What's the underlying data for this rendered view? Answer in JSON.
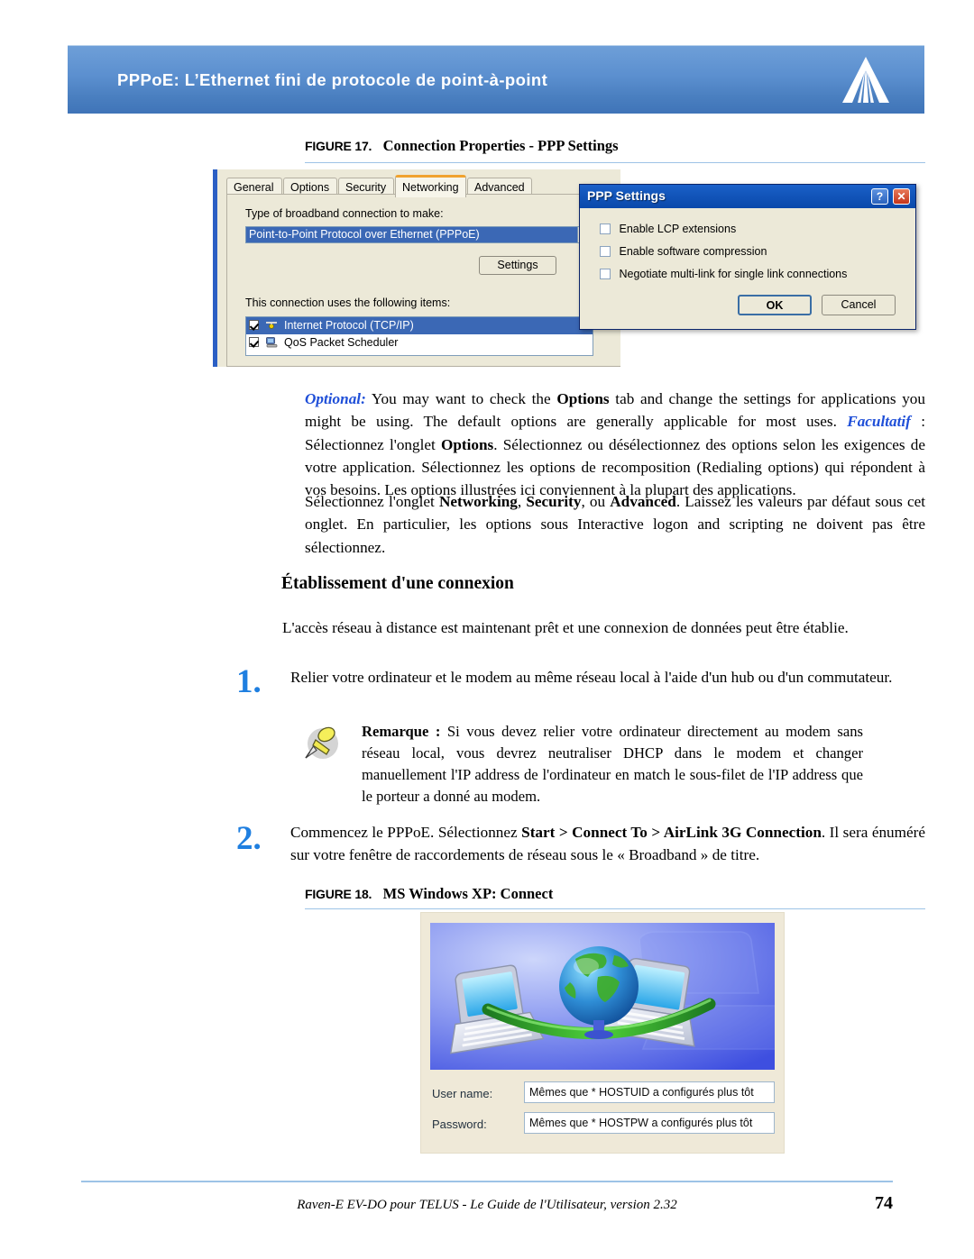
{
  "header": {
    "title": "PPPoE: L’Ethernet fini de protocole de point-à-point",
    "logo_name": "sierra-wireless-logo",
    "banner_color": "#4a7fc0"
  },
  "figure17": {
    "caption_label": "FIGURE 17.",
    "caption_title": "Connection Properties - PPP Settings",
    "connection_properties": {
      "tabs": [
        {
          "label": "General",
          "active": false
        },
        {
          "label": "Options",
          "active": false
        },
        {
          "label": "Security",
          "active": false
        },
        {
          "label": "Networking",
          "active": true
        },
        {
          "label": "Advanced",
          "active": false
        }
      ],
      "type_label": "Type of broadband connection to make:",
      "type_value": "Point-to-Point Protocol over Ethernet (PPPoE)",
      "settings_button": "Settings",
      "items_label": "This connection uses the following items:",
      "items": [
        {
          "label": "Internet Protocol (TCP/IP)",
          "checked": true,
          "selected": true
        },
        {
          "label": "QoS Packet Scheduler",
          "checked": true,
          "selected": false
        }
      ]
    },
    "ppp_settings": {
      "title": "PPP Settings",
      "help_button": "?",
      "close_button": "✕",
      "checkboxes": [
        {
          "label": "Enable LCP extensions",
          "checked": false
        },
        {
          "label": "Enable software compression",
          "checked": false
        },
        {
          "label": "Negotiate multi-link for single link connections",
          "checked": false
        }
      ],
      "ok_button": "OK",
      "cancel_button": "Cancel"
    }
  },
  "body": {
    "para_optional_prefix": "Optional:",
    "para_optional_1": " You may want to check the ",
    "para_optional_options1": "Options",
    "para_optional_2": " tab and change the settings for applications you might be using.  The default options are generally applicable for most uses. ",
    "para_optional_facultatif": "Facultatif",
    "para_optional_3": " : Sélectionnez l'onglet ",
    "para_optional_options2": "Options",
    "para_optional_4": ". Sélectionnez ou désélectionnez des options selon les exigences de votre application. Sélectionnez les options de recomposition (Redialing options) qui répondent à vos besoins. Les options illustrées ici conviennent à la plupart des applications.",
    "para_tabs_1": "Sélectionnez l'onglet ",
    "para_tabs_networking": "Networking",
    "para_tabs_2": ", ",
    "para_tabs_security": "Security",
    "para_tabs_3": ", ou ",
    "para_tabs_advanced": "Advanced",
    "para_tabs_4": ".  Laissez les valeurs par défaut sous cet onglet. En particulier, les options sous Interactive logon and scripting ne doivent pas être sélectionnez.",
    "section_heading": "Établissement d'une connexion",
    "intro_line": "L'accès réseau à distance est maintenant prêt et une connexion de données peut être établie."
  },
  "steps": [
    {
      "number": "1.",
      "text": "Relier votre ordinateur et le modem au même réseau local à l'aide d'un hub ou d'un commutateur."
    },
    {
      "number": "2.",
      "text_1": "Commencez le PPPoE. Sélectionnez ",
      "bold_start": "Start > ",
      "bold_connect": " Connect To > ",
      "bold_airlink": " AirLink 3G Connection",
      "text_2": ". Il sera énuméré sur votre fenêtre de raccordements de réseau sous le « Broadband » de titre."
    }
  ],
  "note": {
    "icon_name": "pushpin-icon",
    "label": "Remarque :",
    "text": " Si vous devez relier votre ordinateur directement au modem sans réseau local, vous devrez neutraliser DHCP dans le modem et changer manuellement l'IP address de l'ordinateur en match le sous-filet de l'IP address que le porteur a donné au modem."
  },
  "figure18": {
    "caption_label": "FIGURE 18.",
    "caption_title": "MS Windows XP: Connect",
    "artwork_name": "globe-with-laptops-illustration",
    "fields": [
      {
        "label": "User name:",
        "value": "Mêmes que * HOSTUID a configurés plus tôt"
      },
      {
        "label": "Password:",
        "value": "Mêmes que * HOSTPW a configurés plus tôt"
      }
    ]
  },
  "footer": {
    "text": "Raven-E EV-DO pour TELUS - Le Guide de l'Utilisateur, version 2.32",
    "page_number": "74"
  }
}
